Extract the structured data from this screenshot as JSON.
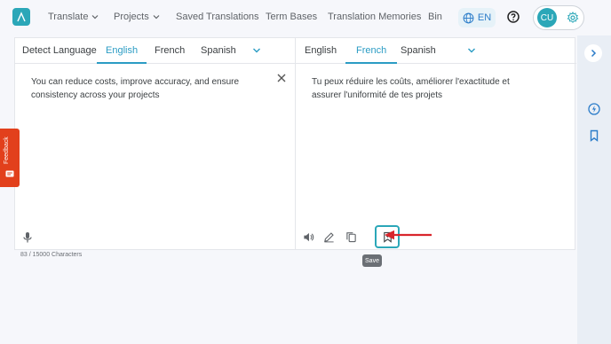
{
  "nav": {
    "items": [
      {
        "label": "Translate"
      },
      {
        "label": "Projects"
      },
      {
        "label": "Saved Translations"
      },
      {
        "label": "Term Bases"
      },
      {
        "label": "Translation Memories"
      },
      {
        "label": "Bin"
      }
    ],
    "ui_language": "EN",
    "user_initials": "CU"
  },
  "source": {
    "tabs": [
      "Detect Language",
      "English",
      "French",
      "Spanish"
    ],
    "active_tab": "English",
    "text": "You can reduce costs, improve accuracy, and ensure consistency across your projects",
    "char_count": "83 / 15000 Characters"
  },
  "target": {
    "tabs": [
      "English",
      "French",
      "Spanish"
    ],
    "active_tab": "French",
    "text": "Tu peux réduire les coûts, améliorer l'exactitude et assurer l'uniformité de tes projets"
  },
  "tooltip": "Save",
  "feedback": "Feedback",
  "colors": {
    "accent": "#2ba7b8",
    "active_tab": "#2b9cc4",
    "feedback": "#e2401c",
    "annotation": "#d9262c"
  }
}
